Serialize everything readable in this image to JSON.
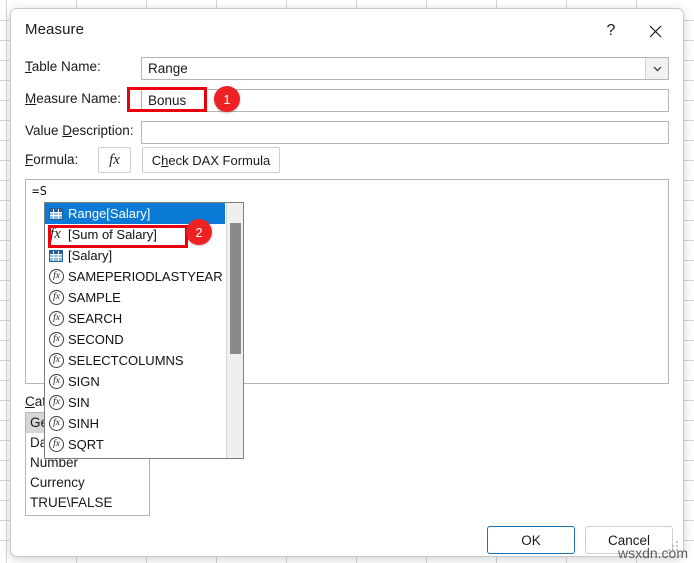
{
  "window": {
    "title": "Measure",
    "help_icon": "question-mark-icon",
    "close_icon": "close-icon"
  },
  "form": {
    "table_name": {
      "label": "Table Name:",
      "accel": "T",
      "value": "Range",
      "dropdown_icon": "chevron-down-icon"
    },
    "measure_name": {
      "label": "Measure Name:",
      "accel": "M",
      "value": "Bonus",
      "placeholder": ""
    },
    "value_description": {
      "label": "Value Description:",
      "accel": "D",
      "value": "",
      "placeholder": ""
    }
  },
  "formula": {
    "label": "Formula:",
    "accel": "F",
    "fx_button": "fx",
    "check_button": "Check DAX Formula",
    "check_button_accel": "h",
    "editor_text": "=S"
  },
  "intellisense": {
    "items": [
      {
        "label": "Range[Salary]",
        "icon": "table-column-icon",
        "selected": true
      },
      {
        "label": "[Sum of Salary]",
        "icon": "measure-fx-icon",
        "selected": false
      },
      {
        "label": "[Salary]",
        "icon": "table-column-icon",
        "selected": false
      },
      {
        "label": "SAMEPERIODLASTYEAR",
        "icon": "function-fx-icon",
        "selected": false
      },
      {
        "label": "SAMPLE",
        "icon": "function-fx-icon",
        "selected": false
      },
      {
        "label": "SEARCH",
        "icon": "function-fx-icon",
        "selected": false
      },
      {
        "label": "SECOND",
        "icon": "function-fx-icon",
        "selected": false
      },
      {
        "label": "SELECTCOLUMNS",
        "icon": "function-fx-icon",
        "selected": false
      },
      {
        "label": "SIGN",
        "icon": "function-fx-icon",
        "selected": false
      },
      {
        "label": "SIN",
        "icon": "function-fx-icon",
        "selected": false
      },
      {
        "label": "SINH",
        "icon": "function-fx-icon",
        "selected": false
      },
      {
        "label": "SQRT",
        "icon": "function-fx-icon",
        "selected": false
      }
    ],
    "scrollbar": "vertical-scrollbar"
  },
  "category": {
    "label": "Category:",
    "accel": "C",
    "options": [
      "General",
      "Date",
      "Number",
      "Currency",
      "TRUE\\FALSE"
    ],
    "selected": "General"
  },
  "footer": {
    "ok_label": "OK",
    "cancel_label": "Cancel"
  },
  "annotations": {
    "badge_1": "1",
    "badge_2": "2",
    "highlight_color": "#e8000d",
    "badge_color": "#ee2222"
  },
  "watermark": "wsxdn.com"
}
